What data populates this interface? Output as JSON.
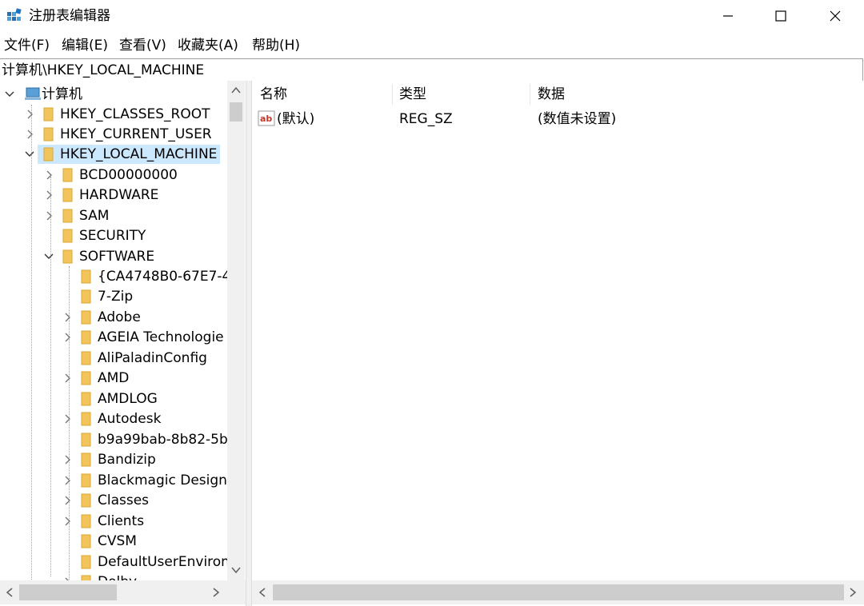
{
  "window": {
    "title": "注册表编辑器",
    "icons": {
      "app": "registry-editor-icon",
      "minimize": "minimize-icon",
      "maximize": "maximize-icon",
      "close": "close-icon"
    }
  },
  "menu": [
    "文件(F)",
    "编辑(E)",
    "查看(V)",
    "收藏夹(A)",
    "帮助(H)"
  ],
  "address": "计算机\\HKEY_LOCAL_MACHINE",
  "tree": {
    "root": "计算机",
    "hives": [
      "HKEY_CLASSES_ROOT",
      "HKEY_CURRENT_USER",
      "HKEY_LOCAL_MACHINE"
    ],
    "selected": "HKEY_LOCAL_MACHINE",
    "hklm_children": [
      "BCD00000000",
      "HARDWARE",
      "SAM",
      "SECURITY",
      "SOFTWARE"
    ],
    "software_children": [
      "{CA4748B0-67E7-4",
      "7-Zip",
      "Adobe",
      "AGEIA Technologie",
      "AliPaladinConfig",
      "AMD",
      "AMDLOG",
      "Autodesk",
      "b9a99bab-8b82-5b",
      "Bandizip",
      "Blackmagic Design",
      "Classes",
      "Clients",
      "CVSM",
      "DefaultUserEnviron",
      "Dolby"
    ]
  },
  "list": {
    "columns": [
      "名称",
      "类型",
      "数据"
    ],
    "rows": [
      {
        "name": "(默认)",
        "type": "REG_SZ",
        "data": "(数值未设置)"
      }
    ]
  },
  "colors": {
    "selection": "#cce8ff",
    "folder": "#f2c55c",
    "scrollbar": "#f0f0f0",
    "thumb": "#cdcdcd"
  }
}
